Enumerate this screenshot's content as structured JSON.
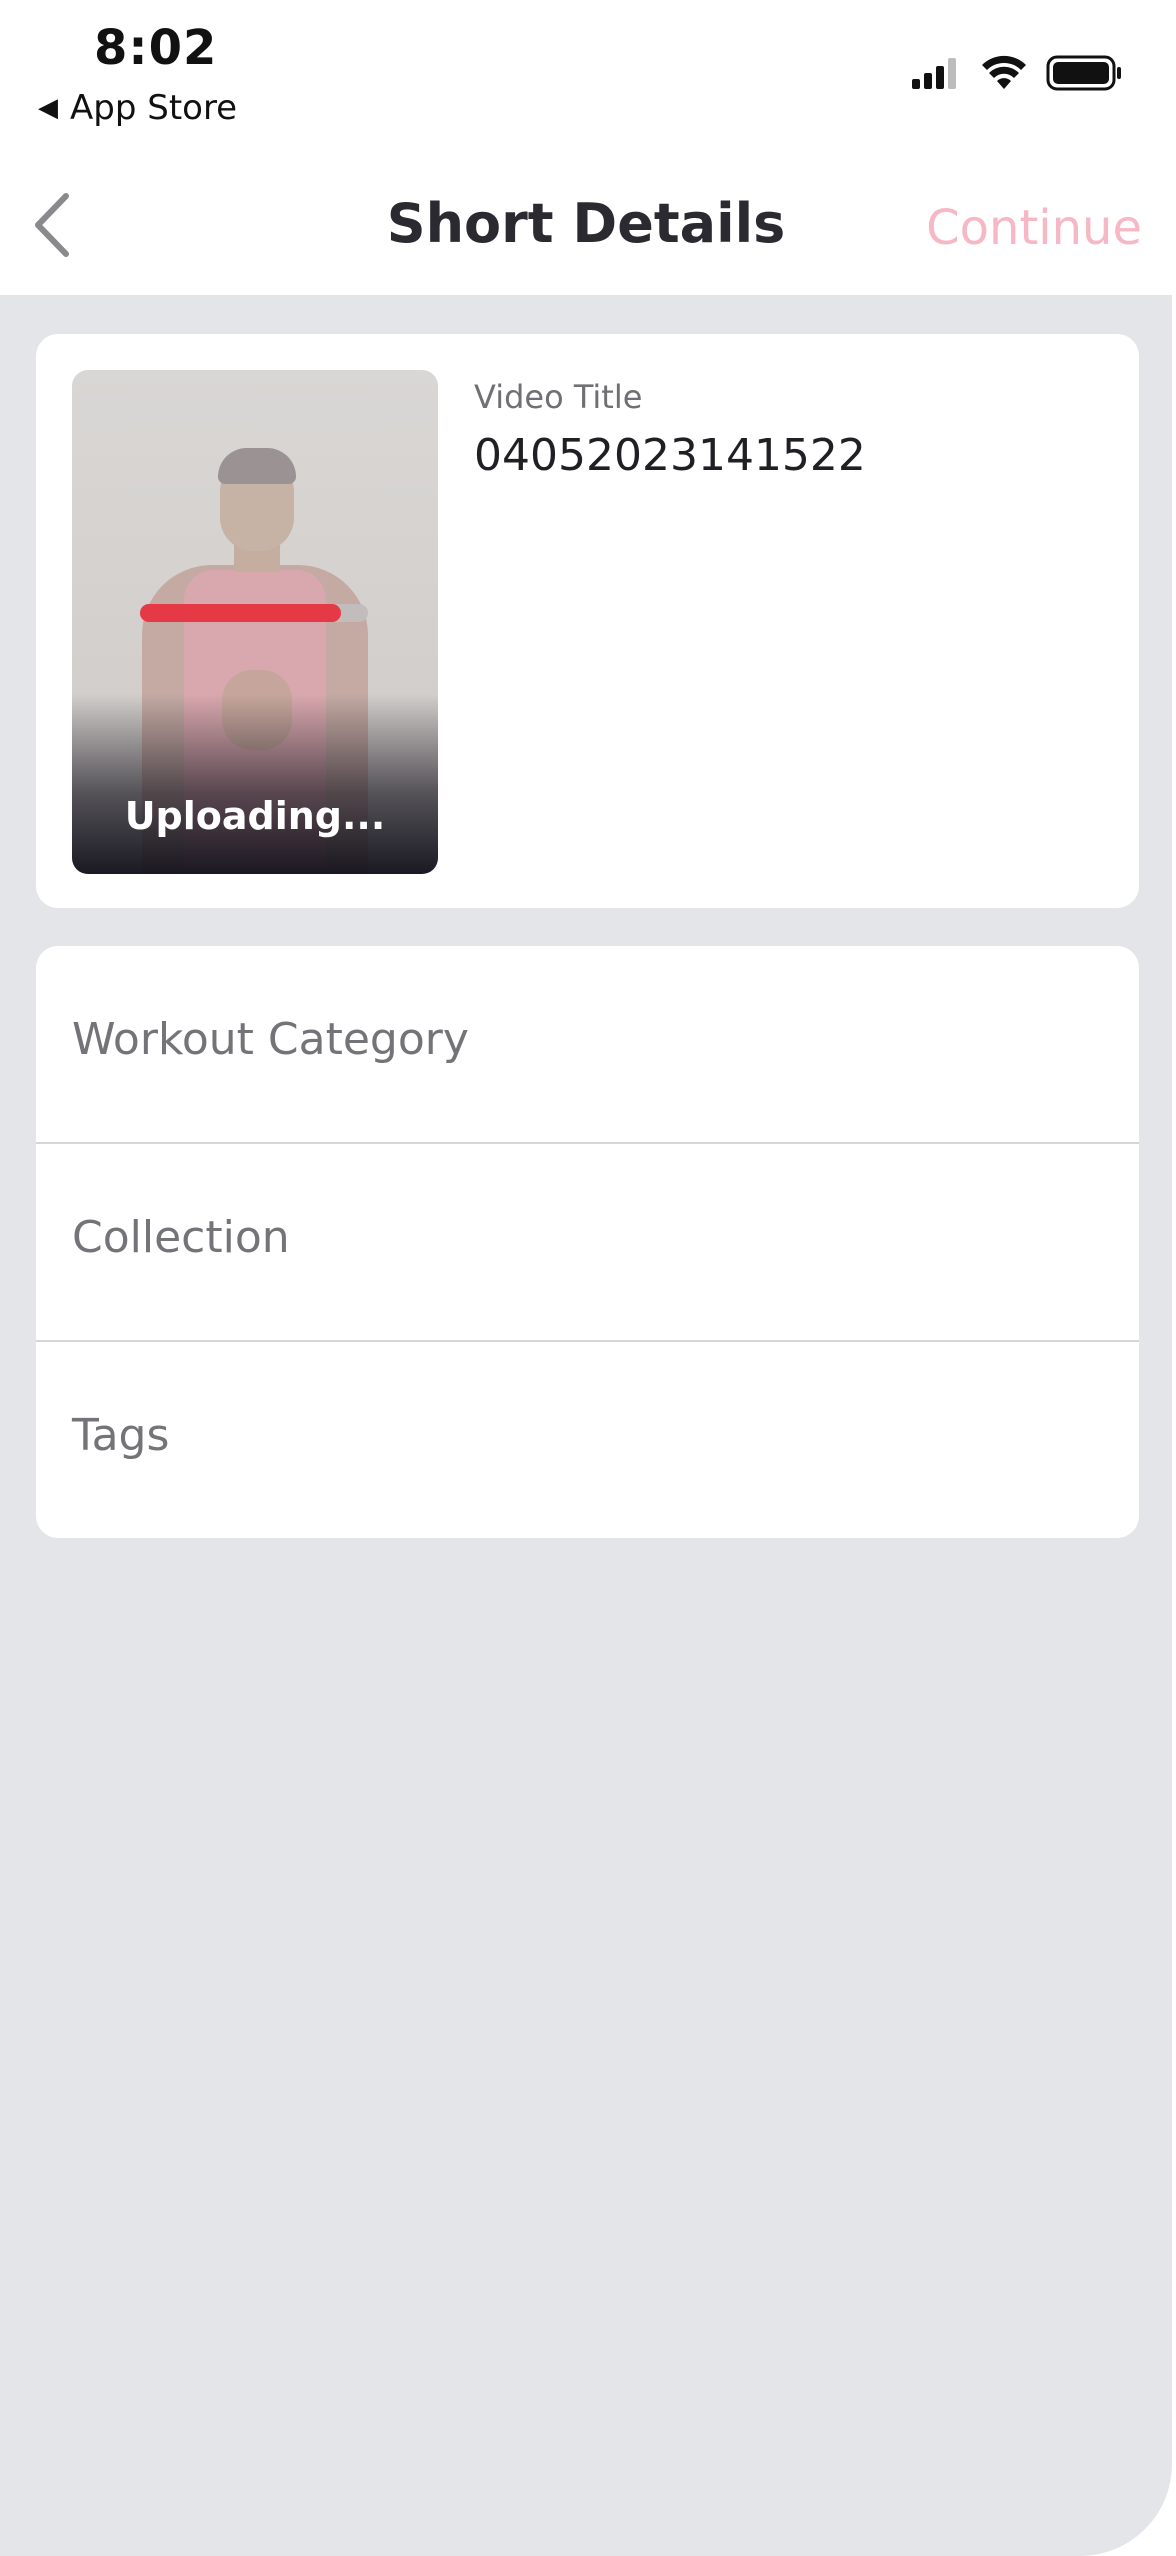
{
  "status_bar": {
    "time": "8:02",
    "back_app": "App Store"
  },
  "nav": {
    "title": "Short Details",
    "continue_label": "Continue",
    "continue_color": "#f7b8c5"
  },
  "video": {
    "upload_status": "Uploading...",
    "progress_fraction": 0.88,
    "progress_color": "#e63946",
    "title_label": "Video Title",
    "title_value": "04052023141522"
  },
  "options": [
    {
      "label": "Workout Category"
    },
    {
      "label": "Collection"
    },
    {
      "label": "Tags"
    }
  ]
}
